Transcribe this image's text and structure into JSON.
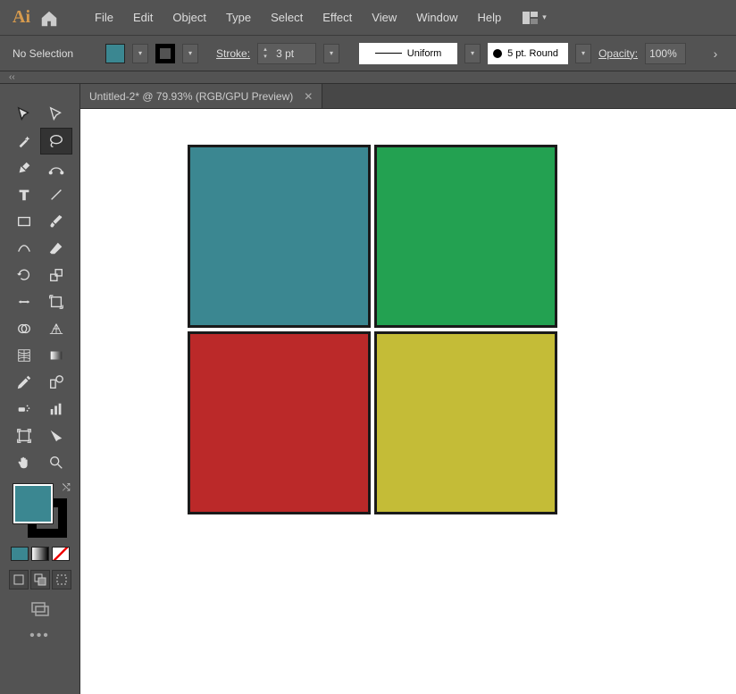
{
  "app": {
    "logo": "Ai"
  },
  "menu": {
    "file": "File",
    "edit": "Edit",
    "object": "Object",
    "type": "Type",
    "select": "Select",
    "effect": "Effect",
    "view": "View",
    "window": "Window",
    "help": "Help"
  },
  "control": {
    "selection": "No Selection",
    "fill_color": "#3b8791",
    "stroke_color": "#000000",
    "stroke_label": "Stroke:",
    "stroke_weight": "3 pt",
    "profile": "Uniform",
    "cap": "5 pt. Round",
    "opacity_label": "Opacity:",
    "opacity": "100%"
  },
  "tab": {
    "title": "Untitled-2* @ 79.93% (RGB/GPU Preview)"
  },
  "tools": {
    "list": [
      "selection",
      "direct-selection",
      "magic-wand",
      "lasso",
      "pen",
      "curvature",
      "type",
      "line",
      "rectangle",
      "paintbrush",
      "shaper",
      "eraser",
      "rotate",
      "scale",
      "width",
      "free-transform",
      "shape-builder",
      "perspective",
      "mesh",
      "gradient",
      "eyedropper",
      "blend",
      "symbol-sprayer",
      "column-graph",
      "artboard",
      "slice",
      "hand",
      "zoom"
    ]
  },
  "colors": {
    "fill": "#3b8791",
    "stroke": "#000000"
  },
  "canvas": {
    "squares": [
      {
        "pos": "tl",
        "color": "#3b8791"
      },
      {
        "pos": "tr",
        "color": "#23a151"
      },
      {
        "pos": "bl",
        "color": "#bb2929"
      },
      {
        "pos": "br",
        "color": "#c4bc37"
      }
    ]
  }
}
